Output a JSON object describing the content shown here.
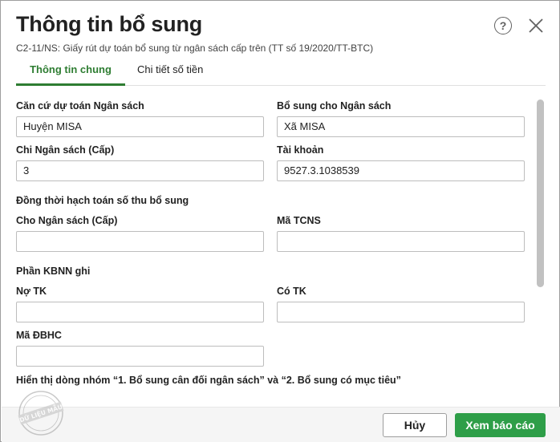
{
  "dialog": {
    "title": "Thông tin bổ sung",
    "subtitle": "C2-11/NS: Giấy rút dự toán bổ sung từ ngân sách cấp trên (TT số 19/2020/TT-BTC)",
    "help_icon_glyph": "?"
  },
  "tabs": [
    {
      "label": "Thông tin chung",
      "active": true
    },
    {
      "label": "Chi tiết số tiền",
      "active": false
    }
  ],
  "form": {
    "can_cu_label": "Căn cứ dự toán Ngân sách",
    "can_cu_value": "Huyện MISA",
    "bo_sung_label": "Bổ sung cho Ngân sách",
    "bo_sung_value": "Xã MISA",
    "chi_ns_label": "Chi Ngân sách (Cấp)",
    "chi_ns_value": "3",
    "tai_khoan_label": "Tài khoản",
    "tai_khoan_value": "9527.3.1038539",
    "dong_thoi_heading": "Đồng thời hạch toán số thu bổ sung",
    "cho_ns_label": "Cho Ngân sách (Cấp)",
    "cho_ns_value": "",
    "ma_tcns_label": "Mã TCNS",
    "ma_tcns_value": "",
    "phan_kbnn_heading": "Phần KBNN ghi",
    "no_tk_label": "Nợ TK",
    "no_tk_value": "",
    "co_tk_label": "Có TK",
    "co_tk_value": "",
    "ma_dbhc_label": "Mã ĐBHC",
    "ma_dbhc_value": "",
    "hien_thi_heading": "Hiển thị dòng nhóm “1. Bổ sung cân đối ngân sách” và “2. Bổ sung có mục tiêu”"
  },
  "footer": {
    "cancel_label": "Hủy",
    "report_label": "Xem báo cáo",
    "watermark_text": "DỮ LIỆU MẪU"
  },
  "colors": {
    "accent": "#2e7d32",
    "primary_button": "#2e9e48"
  }
}
